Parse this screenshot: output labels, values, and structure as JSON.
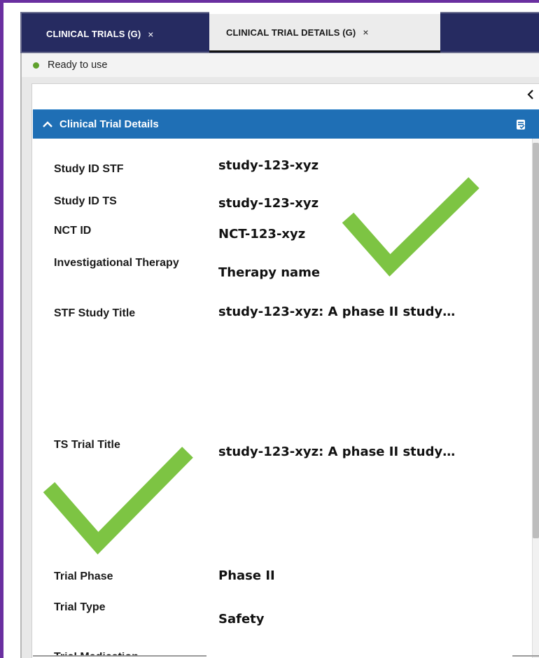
{
  "tabs": [
    {
      "label": "CLINICAL TRIALS (G)",
      "close": "×",
      "active": false
    },
    {
      "label": "CLINICAL TRIAL DETAILS (G)",
      "close": "×",
      "active": true
    }
  ],
  "status": {
    "text": "Ready to use",
    "color": "#5fa12c"
  },
  "section": {
    "title": "Clinical Trial Details",
    "color": "#1f6fb5"
  },
  "fields": [
    {
      "label": "Study ID STF",
      "value": "study-123-xyz"
    },
    {
      "label": "Study ID TS",
      "value": "study-123-xyz"
    },
    {
      "label": "NCT ID",
      "value": "NCT-123-xyz"
    },
    {
      "label": "Investigational Therapy",
      "value": "Therapy name"
    },
    {
      "label": "STF Study Title",
      "value": "study-123-xyz: A phase II study…"
    },
    {
      "label": "TS Trial Title",
      "value": "study-123-xyz: A phase II study…"
    },
    {
      "label": "Trial Phase",
      "value": "Phase II"
    },
    {
      "label": "Trial Type",
      "value": "Safety"
    },
    {
      "label": "Trial Medication"
    }
  ],
  "icons": {
    "tab_close": "close-icon",
    "status": "status-dot-icon",
    "collapse_panel": "chevron-left-icon",
    "section_toggle": "chevron-up-icon",
    "section_action": "edit-form-icon",
    "annotation": "checkmark-icon"
  },
  "annotation_color": "#7dc443",
  "theme": {
    "frame": "#6a2fa0",
    "tabbar": "#262b61"
  }
}
